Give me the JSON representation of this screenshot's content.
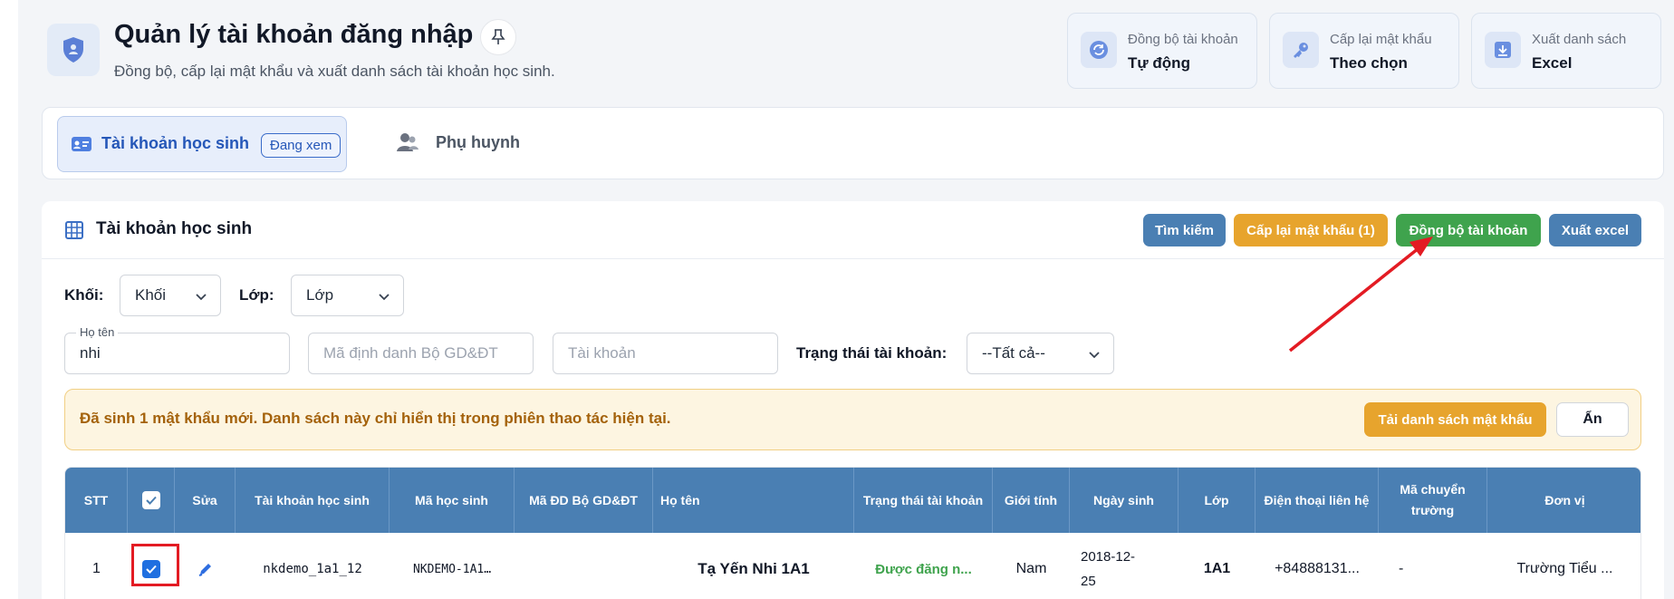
{
  "header": {
    "title": "Quản lý tài khoản đăng nhập",
    "subtitle": "Đồng bộ, cấp lại mật khẩu và xuất danh sách tài khoản học sinh."
  },
  "stats": [
    {
      "label": "Đồng bộ tài khoản",
      "value": "Tự động",
      "icon": "sync-icon"
    },
    {
      "label": "Cấp lại mật khẩu",
      "value": "Theo chọn",
      "icon": "key-icon"
    },
    {
      "label": "Xuất danh sách",
      "value": "Excel",
      "icon": "download-icon"
    }
  ],
  "tabs": {
    "active_label": "Tài khoản học sinh",
    "active_badge": "Đang xem",
    "second_label": "Phụ huynh"
  },
  "panel": {
    "title": "Tài khoản học sinh",
    "buttons": {
      "search": "Tìm kiếm",
      "reset_password": "Cấp lại mật khẩu (1)",
      "sync": "Đồng bộ tài khoản",
      "export": "Xuất excel"
    },
    "colors": {
      "search": "#4a7fb3",
      "reset_password": "#e7a42d",
      "sync": "#3fa34d",
      "export": "#4a7fb3"
    }
  },
  "filters": {
    "grade_label": "Khối:",
    "grade_value": "Khối",
    "class_label": "Lớp:",
    "class_value": "Lớp",
    "name_label": "Họ tên",
    "name_value": "nhi",
    "ministry_id_placeholder": "Mã định danh Bộ GD&ĐT",
    "account_placeholder": "Tài khoản",
    "status_label": "Trạng thái tài khoản:",
    "status_value": "--Tất cả--"
  },
  "alert": {
    "message": "Đã sinh 1 mật khẩu mới. Danh sách này chỉ hiển thị trong phiên thao tác hiện tại.",
    "download_label": "Tải danh sách mật khẩu",
    "hide_label": "Ẩn"
  },
  "table": {
    "headers": {
      "stt": "STT",
      "edit": "Sửa",
      "account": "Tài khoản học sinh",
      "student_code": "Mã học sinh",
      "ministry_code": "Mã ĐD Bộ GD&ĐT",
      "name": "Họ tên",
      "status": "Trạng thái tài khoản",
      "gender": "Giới tính",
      "dob": "Ngày sinh",
      "class": "Lớp",
      "phone": "Điện thoại liên hệ",
      "transfer_code": "Mã chuyển trường",
      "unit": "Đơn vị"
    },
    "rows": [
      {
        "stt": "1",
        "account": "nkdemo_1a1_12",
        "student_code": "NKDEMO-1A1…",
        "ministry_code": "",
        "name": "Tạ Yến Nhi 1A1",
        "status": "Được đăng n...",
        "gender": "Nam",
        "dob": "2018-12-25",
        "class": "1A1",
        "phone": "+84888131...",
        "transfer_code": "-",
        "unit": "Trường Tiểu ..."
      }
    ],
    "status_color": "#3fa34d"
  }
}
